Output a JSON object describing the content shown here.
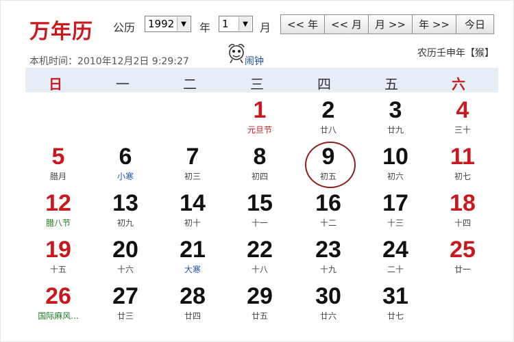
{
  "header": {
    "app_title": "万年历",
    "gregorian_label": "公历",
    "year_value": "1992",
    "year_label": "年",
    "month_value": "1",
    "month_label": "月",
    "nav_buttons": [
      "<< 年",
      "<< 月",
      "月 >>",
      "年 >>",
      "今日"
    ]
  },
  "info": {
    "local_time": "本机时间：2010年12月2日 9:29:27",
    "alarm_label": "闹钟",
    "lunar_year": "农历壬申年【猴】"
  },
  "weekdays": [
    "日",
    "一",
    "二",
    "三",
    "四",
    "五",
    "六"
  ],
  "days": [
    {
      "num": "1",
      "sub": "元旦节"
    },
    {
      "num": "2",
      "sub": "廿八"
    },
    {
      "num": "3",
      "sub": "廿九"
    },
    {
      "num": "4",
      "sub": "三十"
    },
    {
      "num": "5",
      "sub": "腊月"
    },
    {
      "num": "6",
      "sub": "小寒"
    },
    {
      "num": "7",
      "sub": "初三"
    },
    {
      "num": "8",
      "sub": "初四"
    },
    {
      "num": "9",
      "sub": "初五"
    },
    {
      "num": "10",
      "sub": "初六"
    },
    {
      "num": "11",
      "sub": "初七"
    },
    {
      "num": "12",
      "sub": "腊八节"
    },
    {
      "num": "13",
      "sub": "初九"
    },
    {
      "num": "14",
      "sub": "初十"
    },
    {
      "num": "15",
      "sub": "十一"
    },
    {
      "num": "16",
      "sub": "十二"
    },
    {
      "num": "17",
      "sub": "十三"
    },
    {
      "num": "18",
      "sub": "十四"
    },
    {
      "num": "19",
      "sub": "十五"
    },
    {
      "num": "20",
      "sub": "十六"
    },
    {
      "num": "21",
      "sub": "大寒"
    },
    {
      "num": "22",
      "sub": "十八"
    },
    {
      "num": "23",
      "sub": "十九"
    },
    {
      "num": "24",
      "sub": "二十"
    },
    {
      "num": "25",
      "sub": "廿一"
    },
    {
      "num": "26",
      "sub": "国际麻风..."
    },
    {
      "num": "27",
      "sub": "廿三"
    },
    {
      "num": "28",
      "sub": "廿四"
    },
    {
      "num": "29",
      "sub": "廿五"
    },
    {
      "num": "30",
      "sub": "廿六"
    },
    {
      "num": "31",
      "sub": "廿七"
    }
  ],
  "colors": {
    "accent_red": "#c8191e",
    "term_blue": "#1f55a8",
    "festival_green": "#1d7a1d",
    "weekbar_bg": "#e6edf7"
  }
}
